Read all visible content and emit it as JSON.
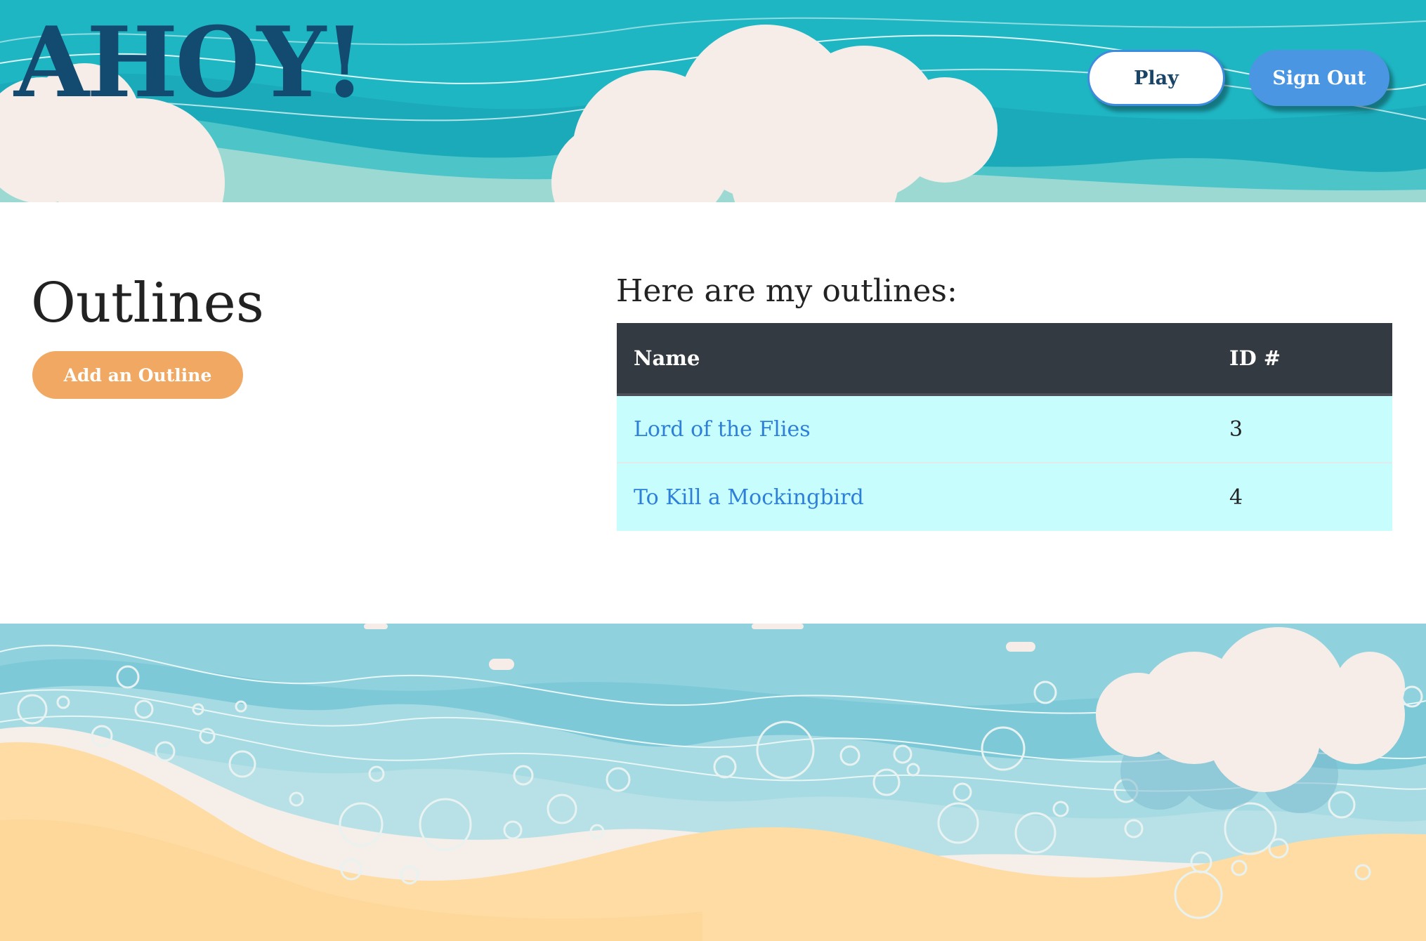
{
  "header": {
    "logo_text": "AHOY!",
    "play_label": "Play",
    "signout_label": "Sign Out"
  },
  "main": {
    "title": "Outlines",
    "add_button_label": "Add an Outline",
    "list_heading": "Here are my outlines:",
    "table": {
      "columns": [
        "Name",
        "ID #"
      ],
      "rows": [
        {
          "name": "Lord of the Flies",
          "id": "3"
        },
        {
          "name": "To Kill a Mockingbird",
          "id": "4"
        }
      ]
    }
  },
  "colors": {
    "header_teal": "#1fb8c5",
    "logo_navy": "#134a70",
    "signout_blue": "#4a96e2",
    "add_orange": "#f0a862",
    "table_header": "#343a42",
    "table_row": "#c8fdfd",
    "link_blue": "#2e7fd8",
    "sand": "#fedca4"
  },
  "icons": [
    "cloud-illustration",
    "wave-illustration",
    "beach-illustration"
  ]
}
